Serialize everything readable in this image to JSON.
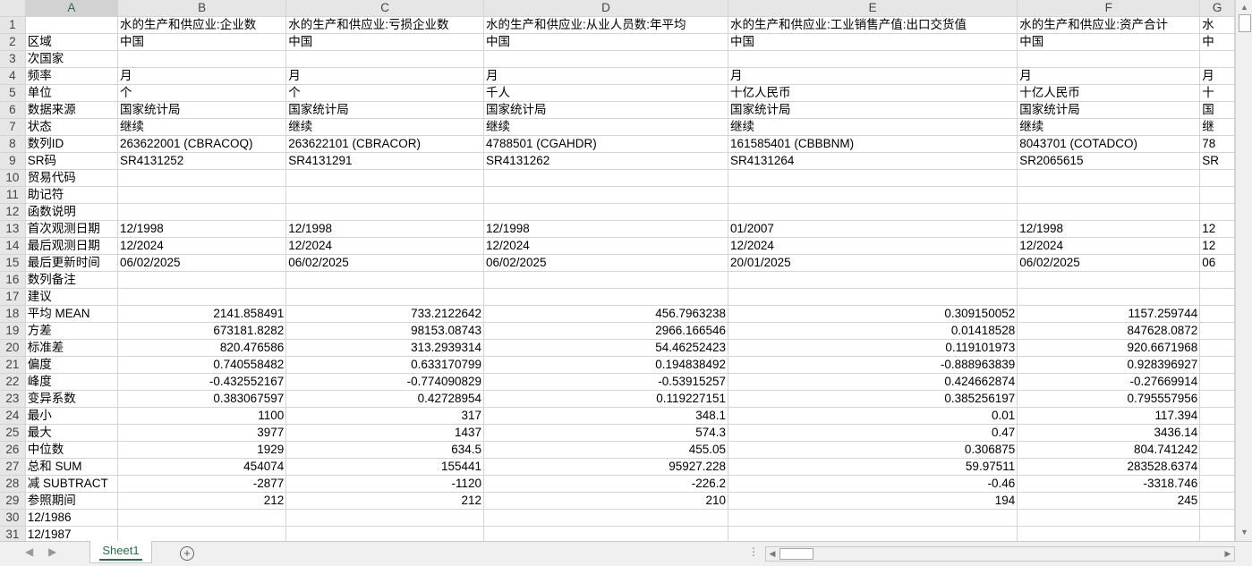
{
  "columns": [
    "A",
    "B",
    "C",
    "D",
    "E",
    "F",
    "G"
  ],
  "selected_column": "A",
  "rows": [
    [
      "",
      "水的生产和供应业:企业数",
      "水的生产和供应业:亏损企业数",
      "水的生产和供应业:从业人员数:年平均",
      "水的生产和供应业:工业销售产值:出口交货值",
      "水的生产和供应业:资产合计",
      "水"
    ],
    [
      "区域",
      "中国",
      "中国",
      "中国",
      "中国",
      "中国",
      "中"
    ],
    [
      "次国家",
      "",
      "",
      "",
      "",
      "",
      ""
    ],
    [
      "频率",
      "月",
      "月",
      "月",
      "月",
      "月",
      "月"
    ],
    [
      "单位",
      "个",
      "个",
      "千人",
      "十亿人民币",
      "十亿人民币",
      "十"
    ],
    [
      "数据来源",
      "国家统计局",
      "国家统计局",
      "国家统计局",
      "国家统计局",
      "国家统计局",
      "国"
    ],
    [
      "状态",
      "继续",
      "继续",
      "继续",
      "继续",
      "继续",
      "继"
    ],
    [
      "数列ID",
      "263622001 (CBRACOQ)",
      "263622101 (CBRACOR)",
      "4788501 (CGAHDR)",
      "161585401 (CBBBNM)",
      "8043701 (COTADCO)",
      "78"
    ],
    [
      "SR码",
      "SR4131252",
      "SR4131291",
      "SR4131262",
      "SR4131264",
      "SR2065615",
      "SR"
    ],
    [
      "贸易代码",
      "",
      "",
      "",
      "",
      "",
      ""
    ],
    [
      "助记符",
      "",
      "",
      "",
      "",
      "",
      ""
    ],
    [
      "函数说明",
      "",
      "",
      "",
      "",
      "",
      ""
    ],
    [
      "首次观测日期",
      "12/1998",
      "12/1998",
      "12/1998",
      "01/2007",
      "12/1998",
      "12"
    ],
    [
      "最后观测日期",
      "12/2024",
      "12/2024",
      "12/2024",
      "12/2024",
      "12/2024",
      "12"
    ],
    [
      "最后更新时间",
      "06/02/2025",
      "06/02/2025",
      "06/02/2025",
      "20/01/2025",
      "06/02/2025",
      "06"
    ],
    [
      "数列备注",
      "",
      "",
      "",
      "",
      "",
      ""
    ],
    [
      "建议",
      "",
      "",
      "",
      "",
      "",
      ""
    ],
    [
      "平均 MEAN",
      "2141.858491",
      "733.2122642",
      "456.7963238",
      "0.309150052",
      "1157.259744",
      ""
    ],
    [
      "方差",
      "673181.8282",
      "98153.08743",
      "2966.166546",
      "0.01418528",
      "847628.0872",
      ""
    ],
    [
      "标准差",
      "820.476586",
      "313.2939314",
      "54.46252423",
      "0.119101973",
      "920.6671968",
      ""
    ],
    [
      "偏度",
      "0.740558482",
      "0.633170799",
      "0.194838492",
      "-0.888963839",
      "0.928396927",
      ""
    ],
    [
      "峰度",
      "-0.432552167",
      "-0.774090829",
      "-0.53915257",
      "0.424662874",
      "-0.27669914",
      ""
    ],
    [
      "变异系数",
      "0.383067597",
      "0.42728954",
      "0.119227151",
      "0.385256197",
      "0.795557956",
      ""
    ],
    [
      "最小",
      "1100",
      "317",
      "348.1",
      "0.01",
      "117.394",
      ""
    ],
    [
      "最大",
      "3977",
      "1437",
      "574.3",
      "0.47",
      "3436.14",
      ""
    ],
    [
      "中位数",
      "1929",
      "634.5",
      "455.05",
      "0.306875",
      "804.741242",
      ""
    ],
    [
      "总和 SUM",
      "454074",
      "155441",
      "95927.228",
      "59.97511",
      "283528.6374",
      ""
    ],
    [
      "减 SUBTRACT",
      "-2877",
      "-1120",
      "-226.2",
      "-0.46",
      "-3318.746",
      ""
    ],
    [
      "参照期间",
      "212",
      "212",
      "210",
      "194",
      "245",
      ""
    ],
    [
      "12/1986",
      "",
      "",
      "",
      "",
      "",
      ""
    ],
    [
      "12/1987",
      "",
      "",
      "",
      "",
      "",
      ""
    ]
  ],
  "numeric_rows_from": 18,
  "numeric_rows_to": 29,
  "sheet_tab": "Sheet1",
  "add_sheet_symbol": "+",
  "tab_nav": {
    "prev": "◀",
    "next": "▶"
  },
  "scroll_dots": "⋮",
  "colors": {
    "accent": "#217346",
    "header_bg": "#e6e6e6",
    "grid": "#d4d4d4"
  }
}
